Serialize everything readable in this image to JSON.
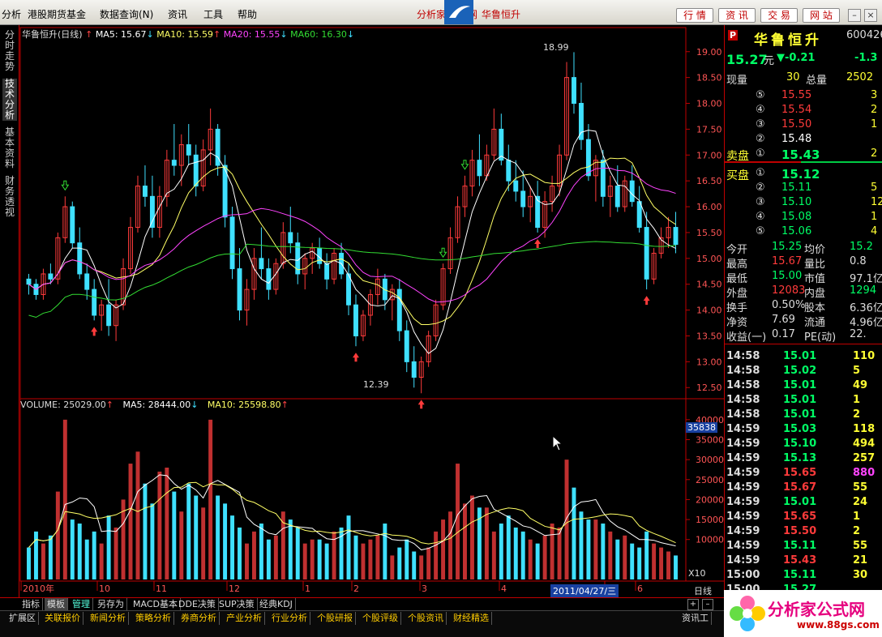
{
  "menubar": {
    "items": [
      "分析",
      "港股期货基金",
      "数据查询(N)",
      "资讯",
      "工具",
      "帮助"
    ],
    "center_title": "分析家",
    "center_title2": "网",
    "stock_name_top": "华鲁恒升",
    "right_buttons": [
      "行 情",
      "资 讯",
      "交 易",
      "网 站"
    ]
  },
  "left_tabs": [
    "分时走势",
    "技术分析",
    "基本资料",
    "财务透视"
  ],
  "kline_legend": {
    "name": "华鲁恒升(日线)",
    "ma5": "MA5: 15.67",
    "ma10": "MA10: 15.59",
    "ma20": "MA20: 15.55",
    "ma60": "MA60: 16.30",
    "high_label": "18.99",
    "low_label": "12.39"
  },
  "volume_legend": {
    "volume": "VOLUME: 25029.00",
    "ma5": "MA5: 28444.00",
    "ma10": "MA10: 25598.80"
  },
  "price_axis": [
    "19.00",
    "18.50",
    "18.00",
    "17.50",
    "17.00",
    "16.50",
    "16.00",
    "15.50",
    "15.00",
    "14.50",
    "14.00",
    "13.50",
    "13.00",
    "12.50"
  ],
  "volume_axis": [
    "40000",
    "35000",
    "30000",
    "25000",
    "20000",
    "15000",
    "10000",
    "X10"
  ],
  "volume_marker": "35838",
  "time_axis": [
    "2010年",
    "10",
    "11",
    "12",
    "1",
    "2",
    "3",
    "4",
    "5",
    "6"
  ],
  "date_cursor": "2011/04/27/三",
  "period_label": "日线",
  "bottom_tabs": [
    "指标",
    "模板",
    "管理",
    "另存为",
    "MACD基本",
    "DDE决策",
    "SUP决策",
    "经典KDJ"
  ],
  "status_tabs": [
    "扩展区",
    "关联报价",
    "新闻分析",
    "策略分析",
    "券商分析",
    "产业分析",
    "行业分析",
    "个股研报",
    "个股评级",
    "个股资讯",
    "财经精选"
  ],
  "status_right": "资讯工",
  "quote": {
    "badge": "P",
    "name": "华鲁恒升",
    "code": "600426",
    "price": "15.27",
    "unit": "元",
    "change": "▼-0.21",
    "change_pct": "-1.3",
    "now_label": "现量",
    "now_val": "30",
    "total_label": "总量",
    "total_val": "2502",
    "sell": [
      {
        "lvl": "⑤",
        "price": "15.55",
        "vol": "3"
      },
      {
        "lvl": "④",
        "price": "15.54",
        "vol": "2"
      },
      {
        "lvl": "③",
        "price": "15.50",
        "vol": "1"
      },
      {
        "lvl": "②",
        "price": "15.48",
        "vol": ""
      },
      {
        "lvl": "①",
        "price": "15.43",
        "vol": "2"
      }
    ],
    "sell_label": "卖盘",
    "buy_label": "买盘",
    "buy": [
      {
        "lvl": "①",
        "price": "15.12",
        "vol": ""
      },
      {
        "lvl": "②",
        "price": "15.11",
        "vol": "5"
      },
      {
        "lvl": "③",
        "price": "15.10",
        "vol": "12"
      },
      {
        "lvl": "④",
        "price": "15.08",
        "vol": "1"
      },
      {
        "lvl": "⑤",
        "price": "15.06",
        "vol": "4"
      }
    ],
    "stats": [
      {
        "l1": "今开",
        "v1": "15.25",
        "l2": "均价",
        "v2": "15.2"
      },
      {
        "l1": "最高",
        "v1": "15.67",
        "l2": "量比",
        "v2": "0.8"
      },
      {
        "l1": "最低",
        "v1": "15.00",
        "l2": "市值",
        "v2": "97.1亿"
      },
      {
        "l1": "外盘",
        "v1": "12083",
        "l2": "内盘",
        "v2": "1294"
      },
      {
        "l1": "换手",
        "v1": "0.50%",
        "l2": "股本",
        "v2": "6.36亿"
      },
      {
        "l1": "净资",
        "v1": "7.69",
        "l2": "流通",
        "v2": "4.96亿"
      },
      {
        "l1": "收益(一)",
        "v1": "0.17",
        "l2": "PE(动)",
        "v2": "22."
      }
    ],
    "ticks": [
      {
        "t": "14:58",
        "p": "15.01",
        "v": "110"
      },
      {
        "t": "14:58",
        "p": "15.02",
        "v": "5"
      },
      {
        "t": "14:58",
        "p": "15.01",
        "v": "49"
      },
      {
        "t": "14:58",
        "p": "15.01",
        "v": "1"
      },
      {
        "t": "14:58",
        "p": "15.01",
        "v": "2"
      },
      {
        "t": "14:59",
        "p": "15.03",
        "v": "118"
      },
      {
        "t": "14:59",
        "p": "15.10",
        "v": "494"
      },
      {
        "t": "14:59",
        "p": "15.13",
        "v": "257"
      },
      {
        "t": "14:59",
        "p": "15.65",
        "v": "880"
      },
      {
        "t": "14:59",
        "p": "15.67",
        "v": "55"
      },
      {
        "t": "14:59",
        "p": "15.01",
        "v": "24"
      },
      {
        "t": "14:59",
        "p": "15.65",
        "v": "1"
      },
      {
        "t": "14:59",
        "p": "15.50",
        "v": "2"
      },
      {
        "t": "14:59",
        "p": "15.11",
        "v": "55"
      },
      {
        "t": "14:59",
        "p": "15.43",
        "v": "21"
      },
      {
        "t": "15:00",
        "p": "15.11",
        "v": "30"
      },
      {
        "t": "15:00",
        "p": "15.27",
        "v": ""
      }
    ]
  },
  "brand": {
    "name": "分析家公式网",
    "url": "www.88gs.com"
  },
  "colors": {
    "up": "#ff3b3b",
    "down": "#3fe0ff",
    "ma5": "#ffffff",
    "ma10": "#ffff66",
    "ma20": "#ff44ff",
    "ma60": "#33dd33",
    "grid": "#c00000"
  },
  "chart_data": {
    "type": "candlestick",
    "ylim": [
      12.3,
      19.2
    ],
    "ohlc": [
      [
        14.6,
        14.7,
        14.3,
        14.5
      ],
      [
        14.5,
        14.6,
        14.2,
        14.3
      ],
      [
        14.3,
        14.8,
        14.2,
        14.7
      ],
      [
        14.7,
        14.9,
        14.5,
        14.6
      ],
      [
        14.6,
        15.5,
        14.5,
        15.4
      ],
      [
        15.4,
        16.2,
        15.3,
        16.0
      ],
      [
        16.0,
        16.1,
        15.2,
        15.3
      ],
      [
        15.3,
        15.6,
        14.6,
        14.7
      ],
      [
        14.7,
        14.9,
        14.2,
        14.4
      ],
      [
        14.4,
        14.6,
        13.8,
        13.9
      ],
      [
        13.9,
        14.2,
        13.6,
        14.1
      ],
      [
        14.1,
        14.6,
        13.5,
        13.7
      ],
      [
        13.7,
        14.2,
        13.4,
        14.1
      ],
      [
        14.1,
        15.0,
        14.0,
        14.8
      ],
      [
        14.8,
        15.8,
        14.7,
        15.6
      ],
      [
        15.6,
        16.6,
        15.5,
        16.4
      ],
      [
        16.4,
        16.8,
        16.0,
        16.2
      ],
      [
        16.2,
        16.6,
        15.4,
        15.6
      ],
      [
        15.6,
        16.4,
        15.4,
        16.2
      ],
      [
        16.2,
        17.1,
        16.0,
        16.9
      ],
      [
        16.9,
        17.6,
        16.6,
        16.8
      ],
      [
        16.8,
        17.4,
        16.4,
        17.2
      ],
      [
        17.2,
        17.6,
        16.8,
        17.0
      ],
      [
        17.0,
        17.2,
        16.2,
        16.4
      ],
      [
        16.4,
        17.3,
        16.3,
        17.1
      ],
      [
        17.1,
        17.9,
        16.8,
        17.5
      ],
      [
        17.5,
        17.6,
        16.6,
        16.8
      ],
      [
        16.8,
        17.0,
        15.6,
        15.8
      ],
      [
        15.8,
        16.0,
        14.6,
        14.8
      ],
      [
        14.8,
        15.2,
        13.8,
        14.0
      ],
      [
        14.0,
        14.6,
        13.7,
        14.4
      ],
      [
        14.4,
        15.2,
        14.2,
        15.0
      ],
      [
        15.0,
        15.6,
        14.6,
        14.8
      ],
      [
        14.8,
        15.0,
        14.2,
        14.4
      ],
      [
        14.4,
        15.0,
        14.3,
        14.9
      ],
      [
        14.9,
        15.7,
        14.8,
        15.5
      ],
      [
        15.5,
        16.0,
        15.1,
        15.3
      ],
      [
        15.3,
        15.5,
        14.5,
        14.7
      ],
      [
        14.7,
        15.1,
        14.4,
        15.0
      ],
      [
        15.0,
        15.3,
        14.7,
        15.2
      ],
      [
        15.2,
        15.4,
        14.8,
        14.9
      ],
      [
        14.9,
        15.1,
        14.4,
        14.6
      ],
      [
        14.6,
        15.2,
        14.5,
        15.1
      ],
      [
        15.1,
        15.3,
        14.6,
        14.7
      ],
      [
        14.7,
        14.9,
        13.9,
        14.1
      ],
      [
        14.1,
        14.3,
        13.3,
        13.5
      ],
      [
        13.5,
        14.0,
        13.4,
        13.9
      ],
      [
        13.9,
        14.4,
        13.7,
        14.3
      ],
      [
        14.3,
        14.8,
        14.1,
        14.6
      ],
      [
        14.6,
        14.7,
        14.0,
        14.2
      ],
      [
        14.2,
        14.5,
        13.8,
        14.4
      ],
      [
        14.4,
        14.6,
        13.4,
        13.6
      ],
      [
        13.6,
        13.8,
        12.8,
        13.0
      ],
      [
        13.0,
        13.3,
        12.5,
        12.7
      ],
      [
        12.7,
        13.1,
        12.39,
        13.0
      ],
      [
        13.0,
        13.6,
        12.9,
        13.5
      ],
      [
        13.5,
        14.2,
        13.4,
        14.1
      ],
      [
        14.1,
        14.9,
        14.0,
        14.8
      ],
      [
        14.8,
        15.6,
        14.7,
        15.4
      ],
      [
        15.4,
        16.2,
        15.3,
        16.0
      ],
      [
        16.0,
        16.6,
        15.8,
        16.4
      ],
      [
        16.4,
        17.1,
        16.2,
        16.9
      ],
      [
        16.9,
        17.4,
        16.4,
        16.6
      ],
      [
        16.6,
        17.2,
        16.5,
        17.0
      ],
      [
        17.0,
        17.9,
        16.9,
        17.5
      ],
      [
        17.5,
        17.8,
        16.8,
        16.9
      ],
      [
        16.9,
        17.2,
        16.3,
        16.5
      ],
      [
        16.5,
        16.9,
        16.1,
        16.3
      ],
      [
        16.3,
        16.7,
        15.8,
        16.0
      ],
      [
        16.0,
        16.4,
        15.7,
        16.2
      ],
      [
        16.2,
        16.5,
        15.5,
        15.6
      ],
      [
        15.6,
        16.3,
        15.4,
        16.1
      ],
      [
        16.1,
        16.6,
        15.9,
        16.4
      ],
      [
        16.4,
        17.2,
        16.2,
        17.0
      ],
      [
        17.0,
        18.8,
        16.9,
        18.5
      ],
      [
        18.5,
        18.99,
        17.8,
        18.0
      ],
      [
        18.0,
        18.4,
        17.1,
        17.3
      ],
      [
        17.3,
        17.6,
        16.5,
        16.6
      ],
      [
        16.6,
        17.0,
        16.1,
        16.9
      ],
      [
        16.9,
        17.1,
        16.0,
        16.2
      ],
      [
        16.2,
        16.6,
        15.8,
        16.4
      ],
      [
        16.4,
        16.8,
        15.9,
        16.0
      ],
      [
        16.0,
        16.6,
        15.9,
        16.5
      ],
      [
        16.5,
        16.8,
        16.0,
        16.1
      ],
      [
        16.1,
        16.4,
        15.5,
        15.6
      ],
      [
        15.6,
        15.9,
        14.4,
        14.6
      ],
      [
        14.6,
        15.2,
        14.5,
        15.1
      ],
      [
        15.1,
        15.6,
        15.0,
        15.4
      ],
      [
        15.4,
        15.8,
        15.2,
        15.6
      ],
      [
        15.6,
        15.9,
        15.1,
        15.27
      ]
    ],
    "volume": [
      8,
      12,
      9,
      11,
      22,
      40,
      15,
      14,
      10,
      12,
      9,
      16,
      13,
      20,
      29,
      32,
      24,
      19,
      27,
      28,
      22,
      17,
      24,
      21,
      18,
      40,
      21,
      19,
      16,
      13,
      9,
      12,
      14,
      10,
      11,
      17,
      15,
      13,
      9,
      10,
      10,
      9,
      12,
      13,
      16,
      11,
      9,
      10,
      11,
      14,
      6,
      8,
      10,
      7,
      6,
      8,
      12,
      15,
      17,
      29,
      19,
      21,
      18,
      18,
      12,
      14,
      16,
      13,
      12,
      10,
      9,
      11,
      14,
      13,
      30,
      23,
      17,
      15,
      15,
      14,
      12,
      10,
      11,
      9,
      8,
      12,
      9,
      8,
      7,
      6
    ],
    "volume_max": 42000
  }
}
